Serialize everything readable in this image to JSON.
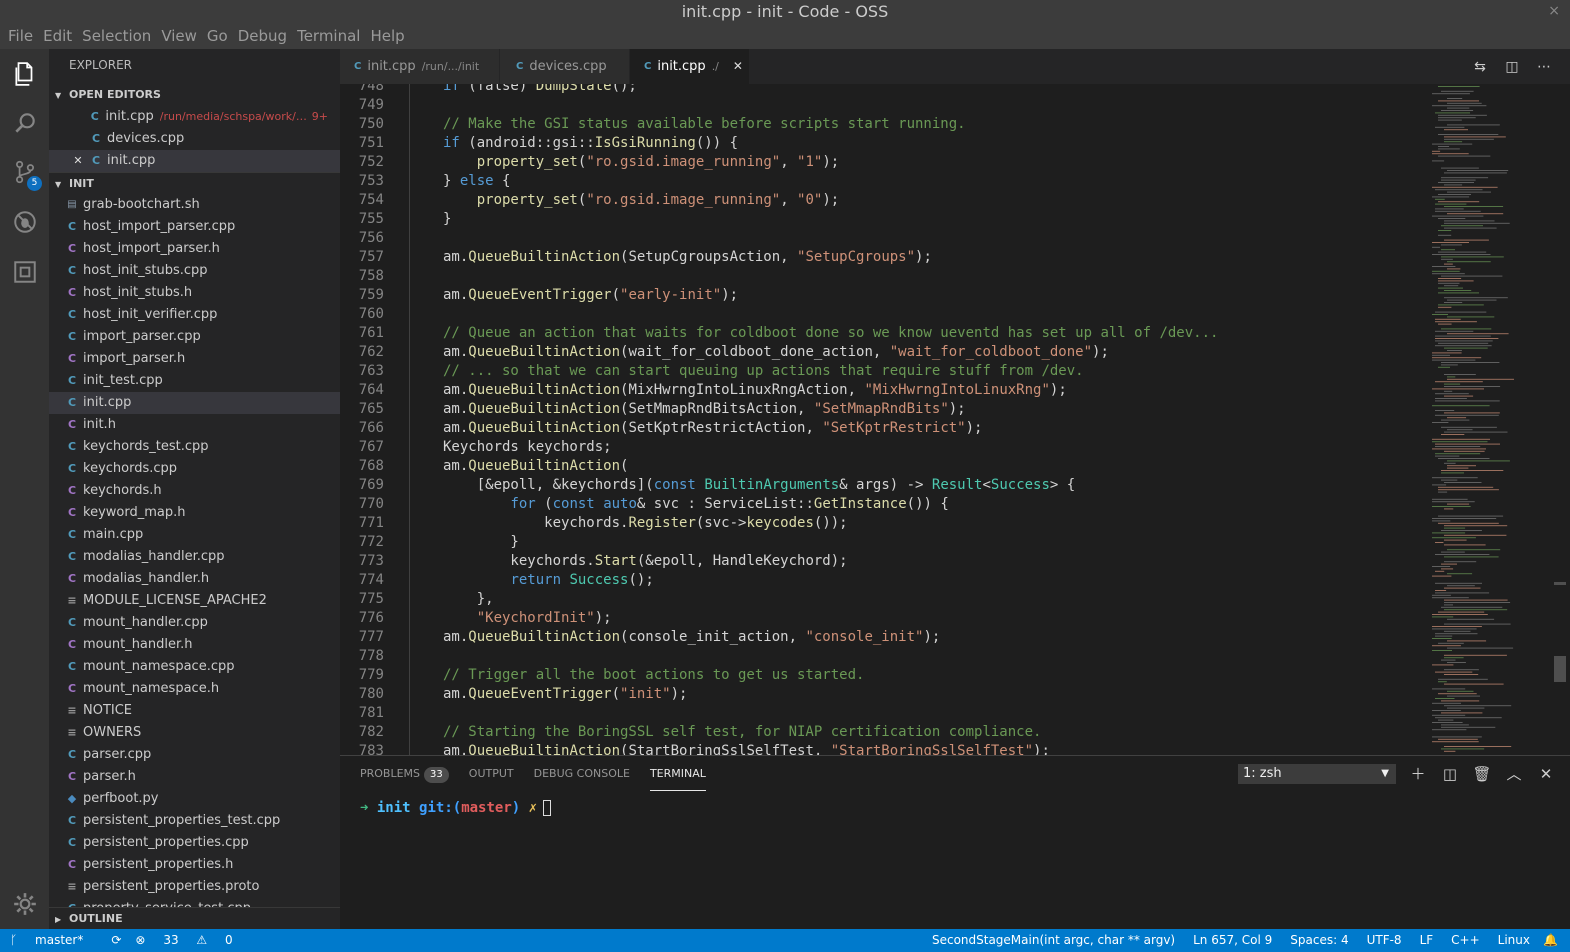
{
  "window": {
    "title": "init.cpp - init - Code - OSS",
    "close_icon": "×"
  },
  "menu": [
    "File",
    "Edit",
    "Selection",
    "View",
    "Go",
    "Debug",
    "Terminal",
    "Help"
  ],
  "activity": {
    "scm_badge": "5"
  },
  "sidebar": {
    "title": "EXPLORER",
    "open_editors": {
      "label": "OPEN EDITORS",
      "items": [
        {
          "name": "init.cpp",
          "path": "/run/media/schspa/work/co...",
          "count": "9+"
        },
        {
          "name": "devices.cpp"
        },
        {
          "name": "init.cpp"
        }
      ]
    },
    "folder": {
      "label": "INIT",
      "files": [
        {
          "name": "grab-bootchart.sh",
          "type": "sh"
        },
        {
          "name": "host_import_parser.cpp",
          "type": "cpp"
        },
        {
          "name": "host_import_parser.h",
          "type": "h"
        },
        {
          "name": "host_init_stubs.cpp",
          "type": "cpp"
        },
        {
          "name": "host_init_stubs.h",
          "type": "h"
        },
        {
          "name": "host_init_verifier.cpp",
          "type": "cpp"
        },
        {
          "name": "import_parser.cpp",
          "type": "cpp"
        },
        {
          "name": "import_parser.h",
          "type": "h"
        },
        {
          "name": "init_test.cpp",
          "type": "cpp"
        },
        {
          "name": "init.cpp",
          "type": "cpp"
        },
        {
          "name": "init.h",
          "type": "h"
        },
        {
          "name": "keychords_test.cpp",
          "type": "cpp"
        },
        {
          "name": "keychords.cpp",
          "type": "cpp"
        },
        {
          "name": "keychords.h",
          "type": "h"
        },
        {
          "name": "keyword_map.h",
          "type": "h"
        },
        {
          "name": "main.cpp",
          "type": "cpp"
        },
        {
          "name": "modalias_handler.cpp",
          "type": "cpp"
        },
        {
          "name": "modalias_handler.h",
          "type": "h"
        },
        {
          "name": "MODULE_LICENSE_APACHE2",
          "type": "txt"
        },
        {
          "name": "mount_handler.cpp",
          "type": "cpp"
        },
        {
          "name": "mount_handler.h",
          "type": "h"
        },
        {
          "name": "mount_namespace.cpp",
          "type": "cpp"
        },
        {
          "name": "mount_namespace.h",
          "type": "h"
        },
        {
          "name": "NOTICE",
          "type": "txt"
        },
        {
          "name": "OWNERS",
          "type": "txt"
        },
        {
          "name": "parser.cpp",
          "type": "cpp"
        },
        {
          "name": "parser.h",
          "type": "h"
        },
        {
          "name": "perfboot.py",
          "type": "py"
        },
        {
          "name": "persistent_properties_test.cpp",
          "type": "cpp"
        },
        {
          "name": "persistent_properties.cpp",
          "type": "cpp"
        },
        {
          "name": "persistent_properties.h",
          "type": "h"
        },
        {
          "name": "persistent_properties.proto",
          "type": "txt"
        },
        {
          "name": "property_service_test.cpp",
          "type": "cpp"
        }
      ]
    },
    "outline_label": "OUTLINE"
  },
  "tabs": [
    {
      "name": "init.cpp",
      "path": "/run/.../init"
    },
    {
      "name": "devices.cpp",
      "path": ""
    },
    {
      "name": "init.cpp",
      "path": "./"
    }
  ],
  "editor": {
    "lines": [
      {
        "n": "748",
        "t": "    if (false) DumpState();"
      },
      {
        "n": "749",
        "t": ""
      },
      {
        "n": "750",
        "t": "    // Make the GSI status available before scripts start running."
      },
      {
        "n": "751",
        "t": "    if (android::gsi::IsGsiRunning()) {"
      },
      {
        "n": "752",
        "t": "        property_set(\"ro.gsid.image_running\", \"1\");"
      },
      {
        "n": "753",
        "t": "    } else {"
      },
      {
        "n": "754",
        "t": "        property_set(\"ro.gsid.image_running\", \"0\");"
      },
      {
        "n": "755",
        "t": "    }"
      },
      {
        "n": "756",
        "t": ""
      },
      {
        "n": "757",
        "t": "    am.QueueBuiltinAction(SetupCgroupsAction, \"SetupCgroups\");"
      },
      {
        "n": "758",
        "t": ""
      },
      {
        "n": "759",
        "t": "    am.QueueEventTrigger(\"early-init\");"
      },
      {
        "n": "760",
        "t": ""
      },
      {
        "n": "761",
        "t": "    // Queue an action that waits for coldboot done so we know ueventd has set up all of /dev..."
      },
      {
        "n": "762",
        "t": "    am.QueueBuiltinAction(wait_for_coldboot_done_action, \"wait_for_coldboot_done\");"
      },
      {
        "n": "763",
        "t": "    // ... so that we can start queuing up actions that require stuff from /dev."
      },
      {
        "n": "764",
        "t": "    am.QueueBuiltinAction(MixHwrngIntoLinuxRngAction, \"MixHwrngIntoLinuxRng\");"
      },
      {
        "n": "765",
        "t": "    am.QueueBuiltinAction(SetMmapRndBitsAction, \"SetMmapRndBits\");"
      },
      {
        "n": "766",
        "t": "    am.QueueBuiltinAction(SetKptrRestrictAction, \"SetKptrRestrict\");"
      },
      {
        "n": "767",
        "t": "    Keychords keychords;"
      },
      {
        "n": "768",
        "t": "    am.QueueBuiltinAction("
      },
      {
        "n": "769",
        "t": "        [&epoll, &keychords](const BuiltinArguments& args) -> Result<Success> {"
      },
      {
        "n": "770",
        "t": "            for (const auto& svc : ServiceList::GetInstance()) {"
      },
      {
        "n": "771",
        "t": "                keychords.Register(svc->keycodes());"
      },
      {
        "n": "772",
        "t": "            }"
      },
      {
        "n": "773",
        "t": "            keychords.Start(&epoll, HandleKeychord);"
      },
      {
        "n": "774",
        "t": "            return Success();"
      },
      {
        "n": "775",
        "t": "        },"
      },
      {
        "n": "776",
        "t": "        \"KeychordInit\");"
      },
      {
        "n": "777",
        "t": "    am.QueueBuiltinAction(console_init_action, \"console_init\");"
      },
      {
        "n": "778",
        "t": ""
      },
      {
        "n": "779",
        "t": "    // Trigger all the boot actions to get us started."
      },
      {
        "n": "780",
        "t": "    am.QueueEventTrigger(\"init\");"
      },
      {
        "n": "781",
        "t": ""
      },
      {
        "n": "782",
        "t": "    // Starting the BoringSSL self test, for NIAP certification compliance."
      },
      {
        "n": "783",
        "t": "    am.QueueBuiltinAction(StartBoringSslSelfTest, \"StartBoringSslSelfTest\");"
      }
    ]
  },
  "panel": {
    "tabs": [
      "PROBLEMS",
      "OUTPUT",
      "DEBUG CONSOLE",
      "TERMINAL"
    ],
    "problems_count": "33",
    "terminal_select": "1: zsh",
    "prompt": {
      "arrow": "➜",
      "dir": "init",
      "git": "git:(",
      "branch": "master",
      "git_close": ")",
      "dirty": "✗"
    }
  },
  "status": {
    "branch": "master*",
    "errors": "33",
    "warnings": "0",
    "function": "SecondStageMain(int argc, char ** argv)",
    "position": "Ln 657, Col 9",
    "spaces": "Spaces: 4",
    "encoding": "UTF-8",
    "eol": "LF",
    "language": "C++",
    "platform": "Linux"
  }
}
